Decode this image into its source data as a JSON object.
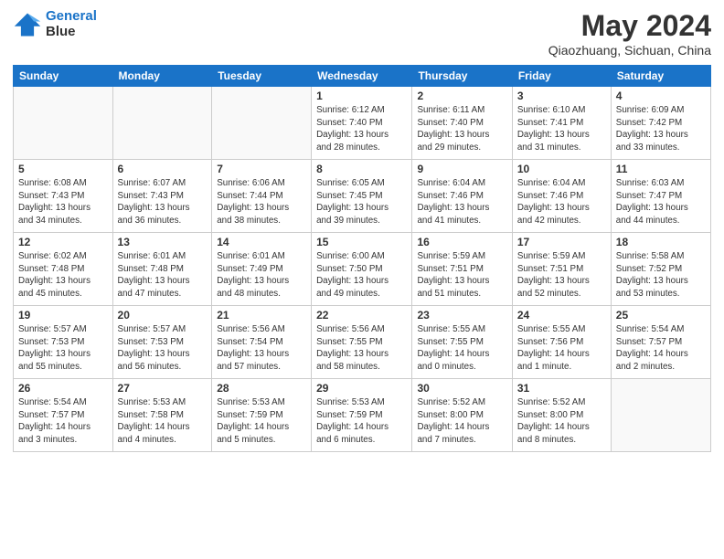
{
  "header": {
    "logo_line1": "General",
    "logo_line2": "Blue",
    "month_year": "May 2024",
    "location": "Qiaozhuang, Sichuan, China"
  },
  "calendar": {
    "days_of_week": [
      "Sunday",
      "Monday",
      "Tuesday",
      "Wednesday",
      "Thursday",
      "Friday",
      "Saturday"
    ],
    "weeks": [
      [
        {
          "day": "",
          "info": ""
        },
        {
          "day": "",
          "info": ""
        },
        {
          "day": "",
          "info": ""
        },
        {
          "day": "1",
          "info": "Sunrise: 6:12 AM\nSunset: 7:40 PM\nDaylight: 13 hours\nand 28 minutes."
        },
        {
          "day": "2",
          "info": "Sunrise: 6:11 AM\nSunset: 7:40 PM\nDaylight: 13 hours\nand 29 minutes."
        },
        {
          "day": "3",
          "info": "Sunrise: 6:10 AM\nSunset: 7:41 PM\nDaylight: 13 hours\nand 31 minutes."
        },
        {
          "day": "4",
          "info": "Sunrise: 6:09 AM\nSunset: 7:42 PM\nDaylight: 13 hours\nand 33 minutes."
        }
      ],
      [
        {
          "day": "5",
          "info": "Sunrise: 6:08 AM\nSunset: 7:43 PM\nDaylight: 13 hours\nand 34 minutes."
        },
        {
          "day": "6",
          "info": "Sunrise: 6:07 AM\nSunset: 7:43 PM\nDaylight: 13 hours\nand 36 minutes."
        },
        {
          "day": "7",
          "info": "Sunrise: 6:06 AM\nSunset: 7:44 PM\nDaylight: 13 hours\nand 38 minutes."
        },
        {
          "day": "8",
          "info": "Sunrise: 6:05 AM\nSunset: 7:45 PM\nDaylight: 13 hours\nand 39 minutes."
        },
        {
          "day": "9",
          "info": "Sunrise: 6:04 AM\nSunset: 7:46 PM\nDaylight: 13 hours\nand 41 minutes."
        },
        {
          "day": "10",
          "info": "Sunrise: 6:04 AM\nSunset: 7:46 PM\nDaylight: 13 hours\nand 42 minutes."
        },
        {
          "day": "11",
          "info": "Sunrise: 6:03 AM\nSunset: 7:47 PM\nDaylight: 13 hours\nand 44 minutes."
        }
      ],
      [
        {
          "day": "12",
          "info": "Sunrise: 6:02 AM\nSunset: 7:48 PM\nDaylight: 13 hours\nand 45 minutes."
        },
        {
          "day": "13",
          "info": "Sunrise: 6:01 AM\nSunset: 7:48 PM\nDaylight: 13 hours\nand 47 minutes."
        },
        {
          "day": "14",
          "info": "Sunrise: 6:01 AM\nSunset: 7:49 PM\nDaylight: 13 hours\nand 48 minutes."
        },
        {
          "day": "15",
          "info": "Sunrise: 6:00 AM\nSunset: 7:50 PM\nDaylight: 13 hours\nand 49 minutes."
        },
        {
          "day": "16",
          "info": "Sunrise: 5:59 AM\nSunset: 7:51 PM\nDaylight: 13 hours\nand 51 minutes."
        },
        {
          "day": "17",
          "info": "Sunrise: 5:59 AM\nSunset: 7:51 PM\nDaylight: 13 hours\nand 52 minutes."
        },
        {
          "day": "18",
          "info": "Sunrise: 5:58 AM\nSunset: 7:52 PM\nDaylight: 13 hours\nand 53 minutes."
        }
      ],
      [
        {
          "day": "19",
          "info": "Sunrise: 5:57 AM\nSunset: 7:53 PM\nDaylight: 13 hours\nand 55 minutes."
        },
        {
          "day": "20",
          "info": "Sunrise: 5:57 AM\nSunset: 7:53 PM\nDaylight: 13 hours\nand 56 minutes."
        },
        {
          "day": "21",
          "info": "Sunrise: 5:56 AM\nSunset: 7:54 PM\nDaylight: 13 hours\nand 57 minutes."
        },
        {
          "day": "22",
          "info": "Sunrise: 5:56 AM\nSunset: 7:55 PM\nDaylight: 13 hours\nand 58 minutes."
        },
        {
          "day": "23",
          "info": "Sunrise: 5:55 AM\nSunset: 7:55 PM\nDaylight: 14 hours\nand 0 minutes."
        },
        {
          "day": "24",
          "info": "Sunrise: 5:55 AM\nSunset: 7:56 PM\nDaylight: 14 hours\nand 1 minute."
        },
        {
          "day": "25",
          "info": "Sunrise: 5:54 AM\nSunset: 7:57 PM\nDaylight: 14 hours\nand 2 minutes."
        }
      ],
      [
        {
          "day": "26",
          "info": "Sunrise: 5:54 AM\nSunset: 7:57 PM\nDaylight: 14 hours\nand 3 minutes."
        },
        {
          "day": "27",
          "info": "Sunrise: 5:53 AM\nSunset: 7:58 PM\nDaylight: 14 hours\nand 4 minutes."
        },
        {
          "day": "28",
          "info": "Sunrise: 5:53 AM\nSunset: 7:59 PM\nDaylight: 14 hours\nand 5 minutes."
        },
        {
          "day": "29",
          "info": "Sunrise: 5:53 AM\nSunset: 7:59 PM\nDaylight: 14 hours\nand 6 minutes."
        },
        {
          "day": "30",
          "info": "Sunrise: 5:52 AM\nSunset: 8:00 PM\nDaylight: 14 hours\nand 7 minutes."
        },
        {
          "day": "31",
          "info": "Sunrise: 5:52 AM\nSunset: 8:00 PM\nDaylight: 14 hours\nand 8 minutes."
        },
        {
          "day": "",
          "info": ""
        }
      ]
    ]
  }
}
